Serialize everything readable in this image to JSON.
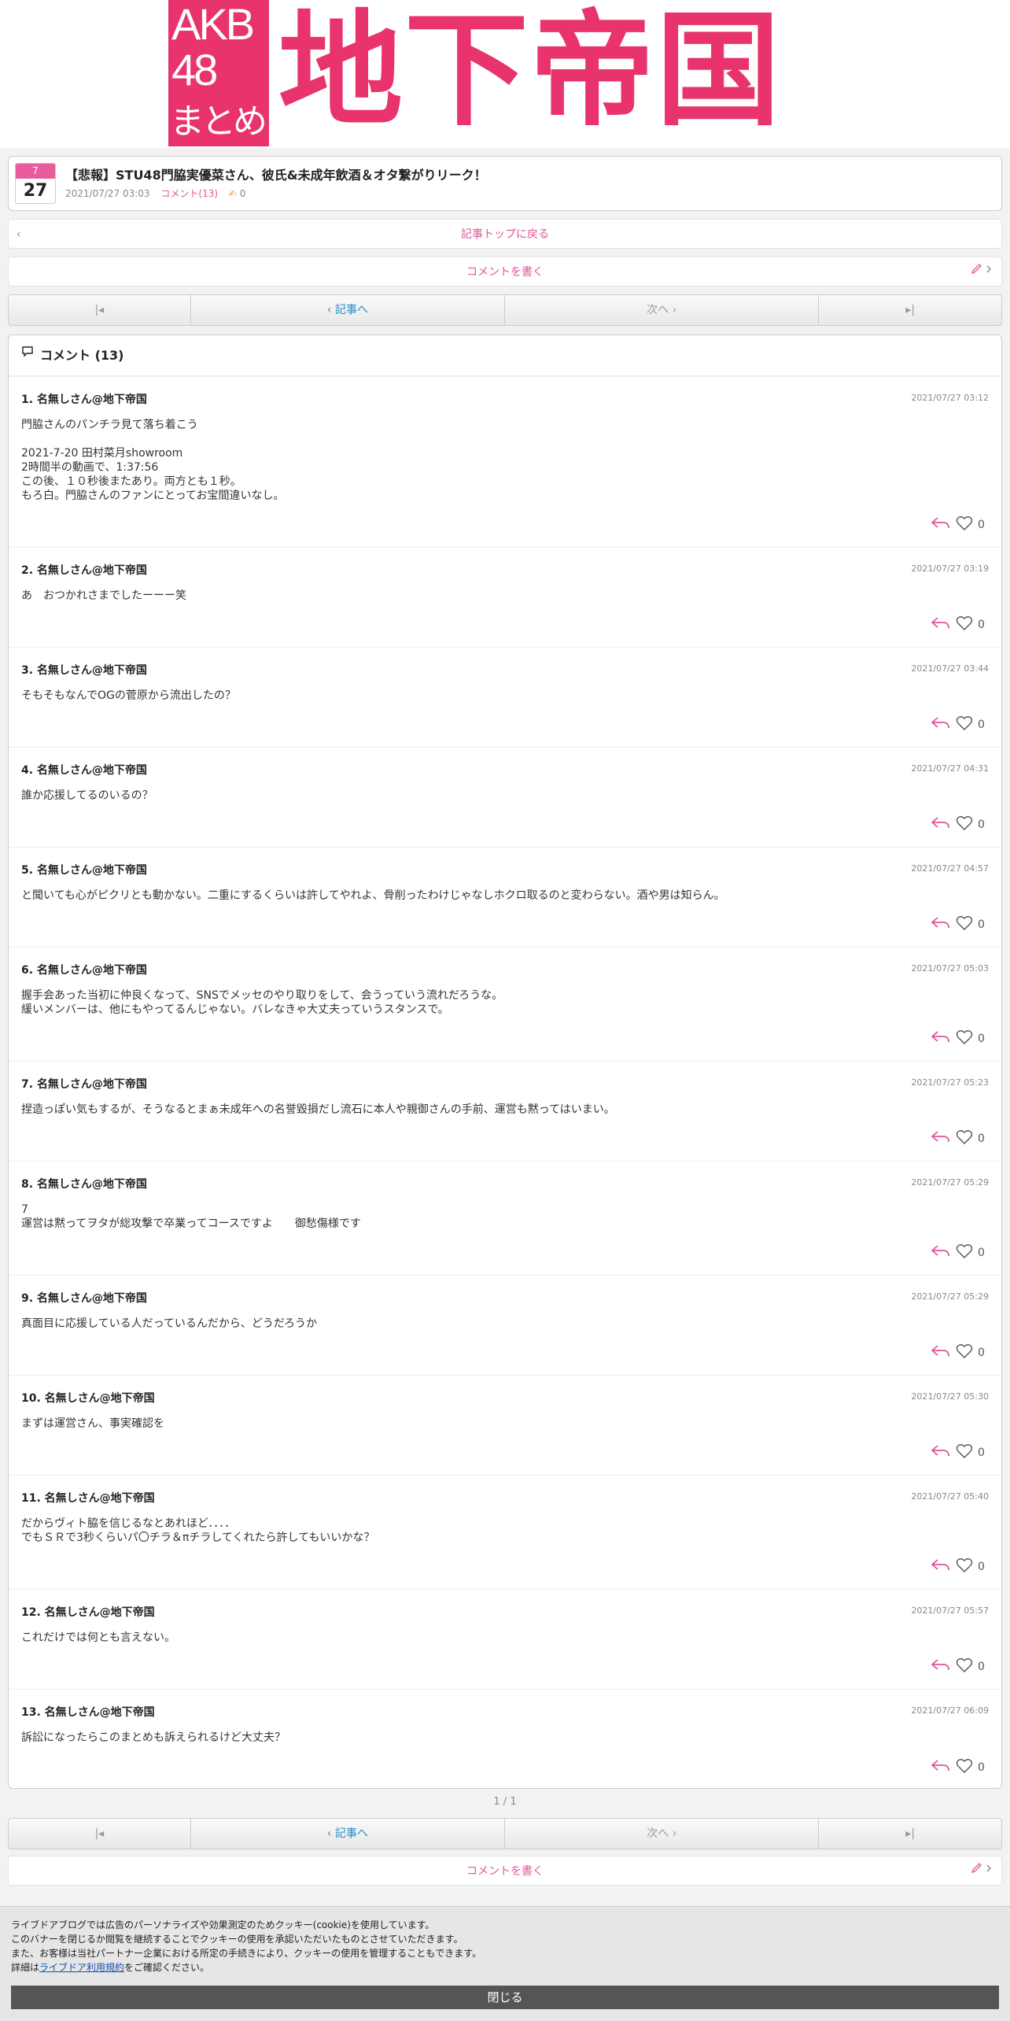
{
  "logo": {
    "line1": "AKB",
    "line2": "48",
    "line3": "まとめ",
    "title": "地下帝国"
  },
  "article": {
    "month": "7",
    "day": "27",
    "title": "【悲報】STU48門脇実優菜さん、彼氏&未成年飲酒＆オタ繋がりリーク！",
    "date": "2021/07/27 03:03",
    "comments": "コメント(13)",
    "likes": "0"
  },
  "nav": {
    "back": "記事トップに戻る",
    "write": "コメントを書く",
    "prev": "記事へ",
    "next": "次へ"
  },
  "comments_header": "コメント (13)",
  "comments": [
    {
      "name": "1.  名無しさん@地下帝国",
      "date": "2021/07/27 03:12",
      "body": "門脇さんのパンチラ見て落ち着こう\n\n2021-7-20 田村菜月showroom\n2時間半の動画で、1:37:56\nこの後、１０秒後またあり。両方とも１秒。\nもろ白。門脇さんのファンにとってお宝間違いなし。",
      "likes": "0"
    },
    {
      "name": "2.  名無しさん@地下帝国",
      "date": "2021/07/27 03:19",
      "body": "あ　おつかれさまでしたーーー笑",
      "likes": "0"
    },
    {
      "name": "3.  名無しさん@地下帝国",
      "date": "2021/07/27 03:44",
      "body": "そもそもなんでOGの菅原から流出したの？",
      "likes": "0"
    },
    {
      "name": "4.  名無しさん@地下帝国",
      "date": "2021/07/27 04:31",
      "body": "誰か応援してるのいるの？",
      "likes": "0"
    },
    {
      "name": "5.  名無しさん@地下帝国",
      "date": "2021/07/27 04:57",
      "body": "と聞いても心がピクリとも動かない。二重にするくらいは許してやれよ、骨削ったわけじゃなしホクロ取るのと変わらない。酒や男は知らん。",
      "likes": "0"
    },
    {
      "name": "6.  名無しさん@地下帝国",
      "date": "2021/07/27 05:03",
      "body": "握手会あった当初に仲良くなって、SNSでメッセのやり取りをして、会うっていう流れだろうな。\n緩いメンバーは、他にもやってるんじゃない。バレなきゃ大丈夫っていうスタンスで。",
      "likes": "0"
    },
    {
      "name": "7.  名無しさん@地下帝国",
      "date": "2021/07/27 05:23",
      "body": "捏造っぽい気もするが、そうなるとまぁ未成年への名誉毀損だし流石に本人や親御さんの手前、運営も黙ってはいまい。",
      "likes": "0"
    },
    {
      "name": "8.  名無しさん@地下帝国",
      "date": "2021/07/27 05:29",
      "body": "7\n運営は黙ってヲタが総攻撃で卒業ってコースですよ　　御愁傷様です",
      "likes": "0"
    },
    {
      "name": "9.  名無しさん@地下帝国",
      "date": "2021/07/27 05:29",
      "body": "真面目に応援している人だっているんだから、どうだろうか",
      "likes": "0"
    },
    {
      "name": "10.  名無しさん@地下帝国",
      "date": "2021/07/27 05:30",
      "body": "まずは運営さん、事実確認を",
      "likes": "0"
    },
    {
      "name": "11.  名無しさん@地下帝国",
      "date": "2021/07/27 05:40",
      "body": "だからヴィト脇を信じるなとあれほど．．．．\nでもＳＲで3秒くらいパ〇チラ＆πチラしてくれたら許してもいいかな？",
      "likes": "0"
    },
    {
      "name": "12.  名無しさん@地下帝国",
      "date": "2021/07/27 05:57",
      "body": "これだけでは何とも言えない。",
      "likes": "0"
    },
    {
      "name": "13.  名無しさん@地下帝国",
      "date": "2021/07/27 06:09",
      "body": "訴訟になったらこのまとめも訴えられるけど大丈夫？",
      "likes": "0"
    }
  ],
  "pagination": "1 / 1",
  "cookie": {
    "text_before": "ライブドアブログでは広告のパーソナライズや効果測定のためクッキー(cookie)を使用しています。\nこのバナーを閉じるか閲覧を継続することでクッキーの使用を承認いただいたものとさせていただきます。\nまた、お客様は当社パートナー企業における所定の手続きにより、クッキーの使用を管理することもできます。\n詳細は",
    "link": "ライブドア利用規約",
    "text_after": "をご確認ください。",
    "close": "閉じる"
  },
  "colors": {
    "accent": "#e8336c",
    "link": "#e0559a",
    "blue": "#2a8cc7"
  }
}
